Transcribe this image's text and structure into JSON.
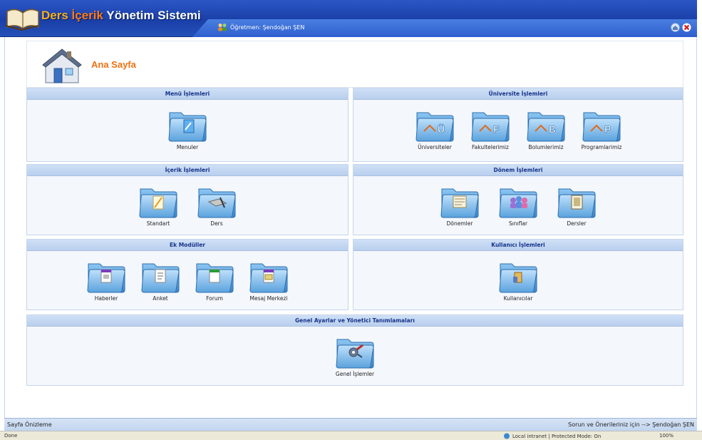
{
  "app": {
    "title_part1": "Ders",
    "title_part2": "İçerik",
    "title_part3": "Yönetim Sistemi",
    "user": "Öğretmen: Şendoğan ŞEN"
  },
  "header": {
    "title": "Ana Sayfa"
  },
  "panels": {
    "menu": {
      "title": "Menü İşlemleri",
      "items": [
        "Menuler"
      ]
    },
    "universite": {
      "title": "Üniversite İşlemleri",
      "items": [
        "Üniversiteler",
        "Fakultelerimiz",
        "Bolumlerimiz",
        "Programlarimiz"
      ],
      "letters": [
        "Ü",
        "F",
        "B",
        "P"
      ]
    },
    "icerik": {
      "title": "İçerik İşlemleri",
      "items": [
        "Standart",
        "Ders"
      ]
    },
    "donem": {
      "title": "Dönem İşlemleri",
      "items": [
        "Dönemler",
        "Sınıflar",
        "Dersler"
      ]
    },
    "ek": {
      "title": "Ek Modüller",
      "items": [
        "Haberler",
        "Anket",
        "Forum",
        "Mesaj Merkezi"
      ]
    },
    "kullanici": {
      "title": "Kullanıcı İşlemleri",
      "items": [
        "Kullanıcılar"
      ]
    },
    "genel": {
      "title": "Genel Ayarlar ve Yönetici Tanımlamaları",
      "items": [
        "Genel İşlemler"
      ]
    }
  },
  "footer": {
    "left": "Sayfa Önizleme",
    "right": "Sorun ve Önerileriniz için --> Şendoğan ŞEN"
  },
  "statusbar": {
    "left": "Done",
    "zone": "Local intranet | Protected Mode: On",
    "zoom": "100%"
  },
  "colors": {
    "titlebar": "#1a3fa8",
    "accent": "#f07010",
    "panel_header": "#b9cfee"
  }
}
